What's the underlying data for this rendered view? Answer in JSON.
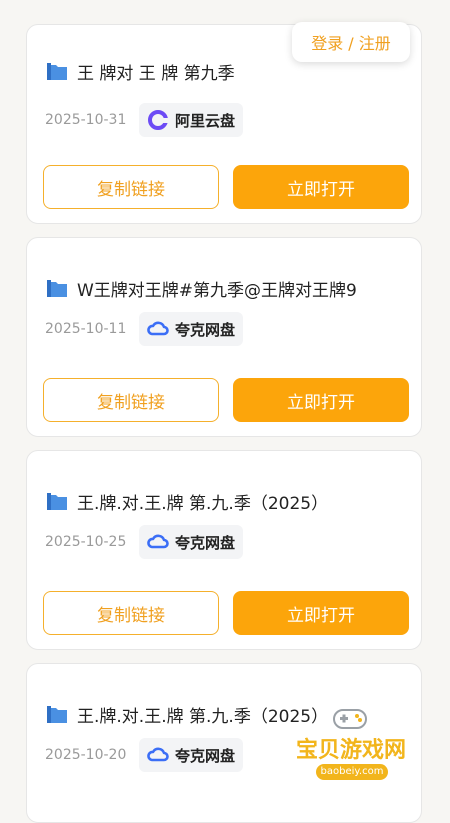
{
  "header": {
    "login_label": "登录 / 注册"
  },
  "actions": {
    "copy_label": "复制链接",
    "open_label": "立即打开"
  },
  "cards": [
    {
      "title": "王 牌对 王 牌 第九季",
      "date": "2025-10-31",
      "provider": "阿里云盘",
      "provider_icon": "aliyun-drive-icon"
    },
    {
      "title": "W王牌对王牌#第九季@王牌对王牌9",
      "date": "2025-10-11",
      "provider": "夸克网盘",
      "provider_icon": "quark-drive-icon"
    },
    {
      "title": "王.牌.对.王.牌 第.九.季（2025）",
      "date": "2025-10-25",
      "provider": "夸克网盘",
      "provider_icon": "quark-drive-icon"
    },
    {
      "title": "王.牌.对.王.牌 第.九.季（2025）",
      "date": "2025-10-20",
      "provider": "夸克网盘",
      "provider_icon": "quark-drive-icon"
    }
  ],
  "watermark": {
    "text": "宝贝游戏网",
    "url": "baobeiy.com"
  },
  "colors": {
    "accent": "#fca50b",
    "folder": "#4a90e2",
    "quark": "#3b6ef6",
    "aliyun": "#6c4bf5"
  }
}
